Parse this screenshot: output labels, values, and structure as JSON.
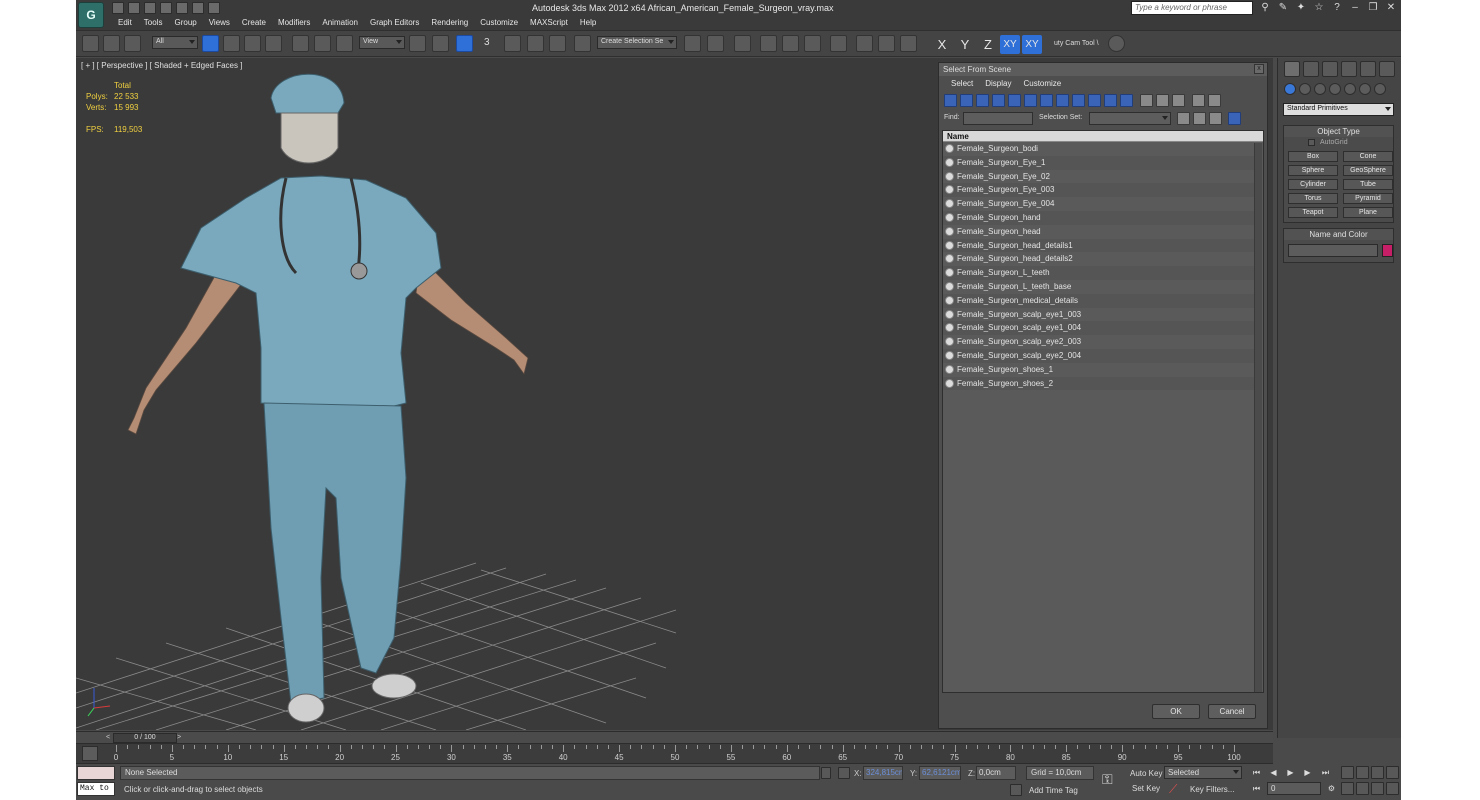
{
  "window": {
    "title": "Autodesk 3ds Max  2012 x64     African_American_Female_Surgeon_vray.max",
    "search_placeholder": "Type a keyword or phrase"
  },
  "menu": [
    "Edit",
    "Tools",
    "Group",
    "Views",
    "Create",
    "Modifiers",
    "Animation",
    "Graph Editors",
    "Rendering",
    "Customize",
    "MAXScript",
    "Help"
  ],
  "toolbar": {
    "filter_value": "All",
    "refcoord_value": "View",
    "selection_set_placeholder": "Create Selection Se",
    "axis_labels": [
      "X",
      "Y",
      "Z",
      "XY",
      "XY"
    ],
    "camera_tool_label": "uty Cam Tool \\",
    "snap_label": "3"
  },
  "viewport": {
    "label": "[ + ] [ Perspective ] [ Shaded + Edged Faces ]",
    "stats": {
      "total_label": "Total",
      "polys_label": "Polys:",
      "polys_value": "22 533",
      "verts_label": "Verts:",
      "verts_value": "15 993",
      "fps_label": "FPS:",
      "fps_value": "119,503"
    }
  },
  "dialog": {
    "title": "Select From Scene",
    "close_glyph": "x",
    "menu": [
      "Select",
      "Display",
      "Customize"
    ],
    "find_label": "Find:",
    "selection_set_label": "Selection Set:",
    "column_name": "Name",
    "items": [
      "Female_Surgeon_bodi",
      "Female_Surgeon_Eye_1",
      "Female_Surgeon_Eye_02",
      "Female_Surgeon_Eye_003",
      "Female_Surgeon_Eye_004",
      "Female_Surgeon_hand",
      "Female_Surgeon_head",
      "Female_Surgeon_head_details1",
      "Female_Surgeon_head_details2",
      "Female_Surgeon_L_teeth",
      "Female_Surgeon_L_teeth_base",
      "Female_Surgeon_medical_details",
      "Female_Surgeon_scalp_eye1_003",
      "Female_Surgeon_scalp_eye1_004",
      "Female_Surgeon_scalp_eye2_003",
      "Female_Surgeon_scalp_eye2_004",
      "Female_Surgeon_shoes_1",
      "Female_Surgeon_shoes_2"
    ],
    "ok_label": "OK",
    "cancel_label": "Cancel"
  },
  "command_panel": {
    "dropdown_value": "Standard Primitives",
    "object_type_title": "Object Type",
    "autogrid_label": "AutoGrid",
    "primitives": [
      "Box",
      "Cone",
      "Sphere",
      "GeoSphere",
      "Cylinder",
      "Tube",
      "Torus",
      "Pyramid",
      "Teapot",
      "Plane"
    ],
    "name_color_title": "Name and Color",
    "object_color": "#c71e68"
  },
  "timeline": {
    "frame_display": "0 / 100",
    "left_arrow": "<",
    "right_arrow": ">",
    "ticks": [
      "0",
      "5",
      "10",
      "15",
      "20",
      "25",
      "30",
      "35",
      "40",
      "45",
      "50",
      "55",
      "60",
      "65",
      "70",
      "75",
      "80",
      "85",
      "90",
      "95",
      "100"
    ]
  },
  "status": {
    "maxscript_label": "Max to",
    "selection_info": "None Selected",
    "prompt": "Click or click-and-drag to select objects",
    "x_label": "X:",
    "x_value": "324,815cm",
    "y_label": "Y:",
    "y_value": "62,6121cm",
    "z_label": "Z:",
    "z_value": "0,0cm",
    "grid": "Grid = 10,0cm",
    "add_time_tag": "Add Time Tag",
    "auto_key": "Auto Key",
    "set_key": "Set Key",
    "keying_set_value": "Selected",
    "key_filters": "Key Filters...",
    "frame_value": "0"
  }
}
